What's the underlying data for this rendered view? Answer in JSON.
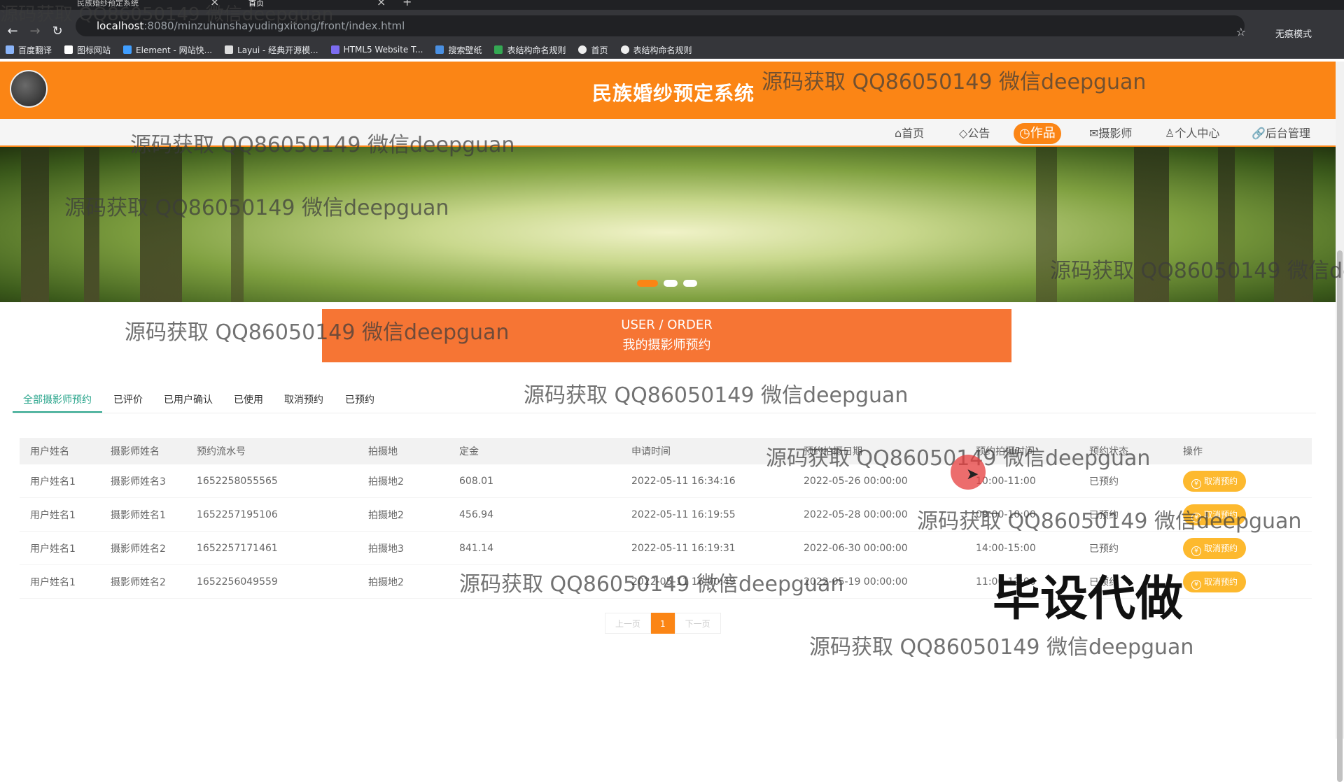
{
  "browser": {
    "tabs": [
      {
        "title": "民族婚纱预定系统"
      },
      {
        "title": "首页"
      }
    ],
    "address_host": "localhost",
    "address_path": ":8080/minzuhunshayudingxitong/front/index.html",
    "incognito_label": "无痕模式",
    "bookmarks": [
      {
        "label": "百度翻译"
      },
      {
        "label": "图标网站"
      },
      {
        "label": "Element - 网站快..."
      },
      {
        "label": "Layui - 经典开源模..."
      },
      {
        "label": "HTML5 Website T..."
      },
      {
        "label": "搜索壁纸"
      },
      {
        "label": "表结构命名规则"
      },
      {
        "label": "首页"
      },
      {
        "label": "表结构命名规则"
      }
    ]
  },
  "site": {
    "title": "民族婚纱预定系统",
    "nav": [
      {
        "label": "⌂首页"
      },
      {
        "label": "◇公告"
      },
      {
        "label": "◷作品"
      },
      {
        "label": "✉摄影师"
      },
      {
        "label": "♙个人中心"
      },
      {
        "label": "🔗后台管理"
      }
    ]
  },
  "section": {
    "en": "USER / ORDER",
    "cn": "我的摄影师预约"
  },
  "tabs": [
    "全部摄影师预约",
    "已评价",
    "已用户确认",
    "已使用",
    "取消预约",
    "已预约"
  ],
  "table": {
    "headers": [
      "用户姓名",
      "摄影师姓名",
      "预约流水号",
      "拍摄地",
      "定金",
      "申请时间",
      "预约拍摄日期",
      "预约拍摄时间",
      "预约状态",
      "操作"
    ],
    "rows": [
      [
        "用户姓名1",
        "摄影师姓名3",
        "1652258055565",
        "拍摄地2",
        "608.01",
        "2022-05-11 16:34:16",
        "2022-05-26 00:00:00",
        "10:00-11:00",
        "已预约",
        "取消预约"
      ],
      [
        "用户姓名1",
        "摄影师姓名1",
        "1652257195106",
        "拍摄地2",
        "456.94",
        "2022-05-11 16:19:55",
        "2022-05-28 00:00:00",
        "09:00-10:00",
        "已预约",
        "取消预约"
      ],
      [
        "用户姓名1",
        "摄影师姓名2",
        "1652257171461",
        "拍摄地3",
        "841.14",
        "2022-05-11 16:19:31",
        "2022-06-30 00:00:00",
        "14:00-15:00",
        "已预约",
        "取消预约"
      ],
      [
        "用户姓名1",
        "摄影师姓名2",
        "1652256049559",
        "拍摄地2",
        "",
        "2022-05-11 16:00:49",
        "2022-05-19 00:00:00",
        "11:00-12:00",
        "已预约",
        "取消预约"
      ]
    ]
  },
  "pager": {
    "prev": "上一页",
    "current": "1",
    "next": "下一页"
  },
  "watermarks": {
    "text": "源码获取 QQ86050149 微信deepguan",
    "big": "毕设代做"
  }
}
